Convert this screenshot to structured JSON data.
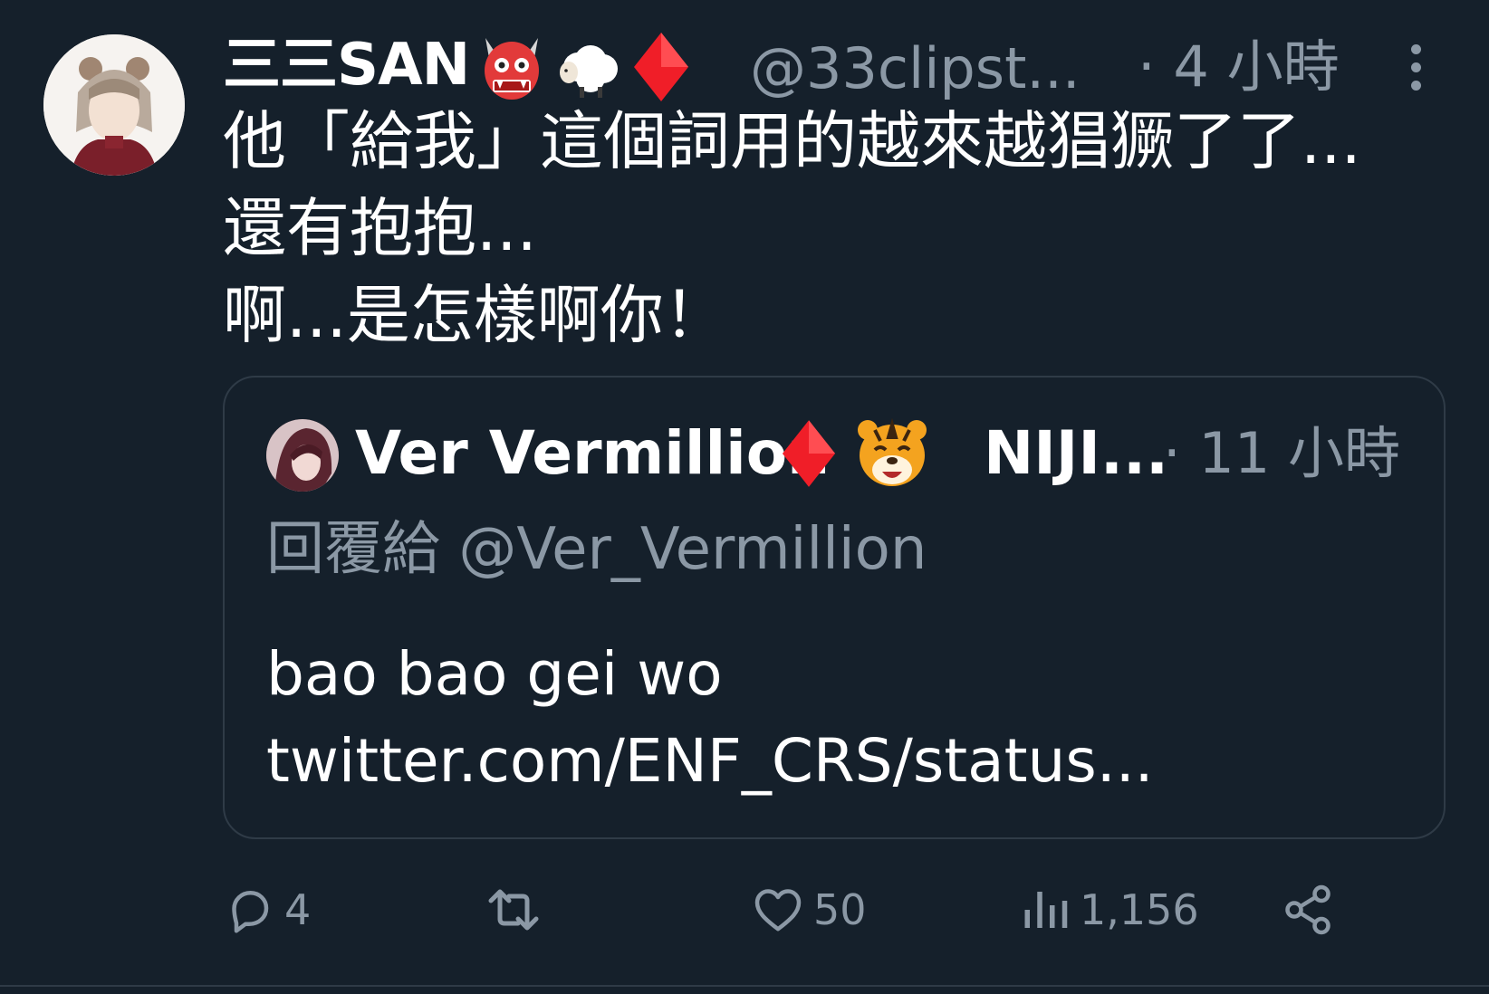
{
  "tweet": {
    "display_name": "三三SAN",
    "handle": "@33clipst...",
    "time": "· 4 小時",
    "body_lines": [
      "他「給我」這個詞用的越來越猖獗了了...",
      "還有抱抱...",
      "啊...是怎樣啊你！"
    ]
  },
  "quote": {
    "display_name": "Ver Vermillion",
    "display_name_suffix": "NIJI...",
    "time": "· 11 小時",
    "reply_to": "回覆給 @Ver_Vermillion",
    "text_lines": [
      "bao bao gei wo",
      "twitter.com/ENF_CRS/status..."
    ]
  },
  "actions": {
    "reply_count": "4",
    "retweet_count": "",
    "like_count": "50",
    "view_count": "1,156"
  },
  "icons": {
    "more": "more-vertical-icon",
    "reply": "reply-icon",
    "retweet": "retweet-icon",
    "like": "heart-icon",
    "views": "views-icon",
    "share": "share-icon"
  },
  "colors": {
    "background": "#15202b",
    "secondary_text": "#8b98a5",
    "border": "#2f3b47",
    "diamond": "#f01e28"
  }
}
